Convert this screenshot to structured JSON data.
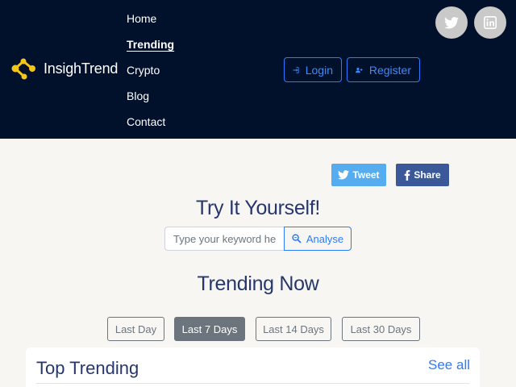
{
  "brand": {
    "name": "InsighTrend",
    "accent_color": "#f5c518"
  },
  "nav": {
    "items": [
      {
        "label": "Home",
        "active": false
      },
      {
        "label": "Trending",
        "active": true
      },
      {
        "label": "Crypto",
        "active": false
      },
      {
        "label": "Blog",
        "active": false
      },
      {
        "label": "Contact",
        "active": false
      }
    ]
  },
  "auth": {
    "login_label": "Login",
    "register_label": "Register",
    "login_icon": "sign-in-icon",
    "register_icon": "user-plus-icon"
  },
  "social": {
    "twitter_icon": "twitter-icon",
    "linkedin_icon": "linkedin-icon"
  },
  "share": {
    "tweet_label": "Tweet",
    "share_label": "Share"
  },
  "try": {
    "title": "Try It Yourself!",
    "placeholder": "Type your keyword here",
    "analyse_label": "Analyse"
  },
  "trending": {
    "title": "Trending Now",
    "periods": [
      {
        "label": "Last Day",
        "active": false
      },
      {
        "label": "Last 7 Days",
        "active": true
      },
      {
        "label": "Last 14 Days",
        "active": false
      },
      {
        "label": "Last 30 Days",
        "active": false
      }
    ]
  },
  "top_trending": {
    "title": "Top Trending",
    "see_all_label": "See all"
  },
  "colors": {
    "header_bg": "#02112b",
    "primary": "#2a7bff",
    "heading": "#26376c",
    "page_bg": "#f8f6f3"
  }
}
